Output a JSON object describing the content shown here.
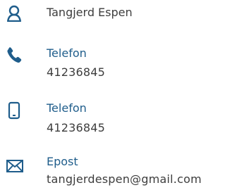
{
  "contact": {
    "name": "Tangjerd Espen",
    "phone": {
      "label": "Telefon",
      "value": "41236845",
      "icon": "phone-icon"
    },
    "mobile": {
      "label": "Telefon",
      "value": "41236845",
      "icon": "mobile-phone-icon"
    },
    "email": {
      "label": "Epost",
      "value": "tangjerdespen@gmail.com",
      "icon": "envelope-icon"
    },
    "person_icon": "person-icon"
  },
  "colors": {
    "icon": "#1f5d8b",
    "link": "#1f5d8b",
    "text": "#3d3d3d"
  }
}
